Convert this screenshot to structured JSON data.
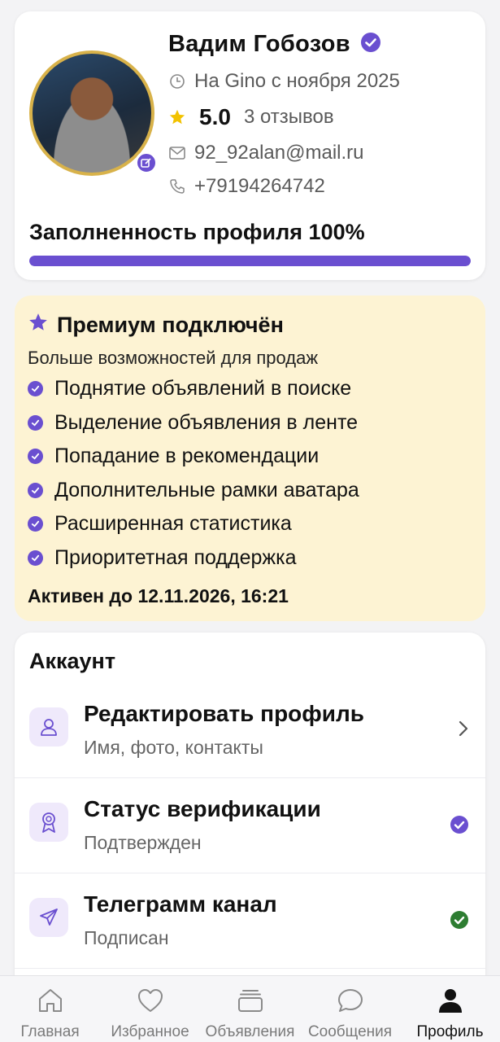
{
  "profile": {
    "name": "Вадим Гобозов",
    "since": "На Gino с ноября 2025",
    "rating": "5.0",
    "reviews": "3 отзывов",
    "email": "92_92alan@mail.ru",
    "phone": "+79194264742",
    "completeness_label": "Заполненность профиля 100%",
    "completeness_value": 1.0
  },
  "premium": {
    "title": "Премиум подключён",
    "subtitle": "Больше возможностей для продаж",
    "features": [
      "Поднятие объявлений в поиске",
      "Выделение объявления в ленте",
      "Попадание в рекомендации",
      "Дополнительные рамки аватара",
      "Расширенная статистика",
      "Приоритетная поддержка"
    ],
    "active_until": "Активен до 12.11.2026, 16:21"
  },
  "account": {
    "title": "Аккаунт",
    "items": [
      {
        "label": "Редактировать профиль",
        "sub": "Имя, фото, контакты",
        "icon": "user-icon",
        "right": "chevron-right-icon"
      },
      {
        "label": "Статус верификации",
        "sub": "Подтвержден",
        "icon": "badge-icon",
        "right": "verified-check-icon"
      },
      {
        "label": "Телеграмм канал",
        "sub": "Подписан",
        "icon": "send-icon",
        "right": "green-check-icon"
      }
    ]
  },
  "nav": {
    "items": [
      {
        "label": "Главная",
        "icon": "home-icon"
      },
      {
        "label": "Избранное",
        "icon": "heart-icon"
      },
      {
        "label": "Объявления",
        "icon": "listings-icon"
      },
      {
        "label": "Сообщения",
        "icon": "chat-icon"
      },
      {
        "label": "Профиль",
        "icon": "profile-icon",
        "active": true
      }
    ]
  },
  "colors": {
    "accent": "#6a4fd0",
    "gold": "#f2c200",
    "premium_bg": "#fdf3d3",
    "success": "#2e7d32"
  }
}
